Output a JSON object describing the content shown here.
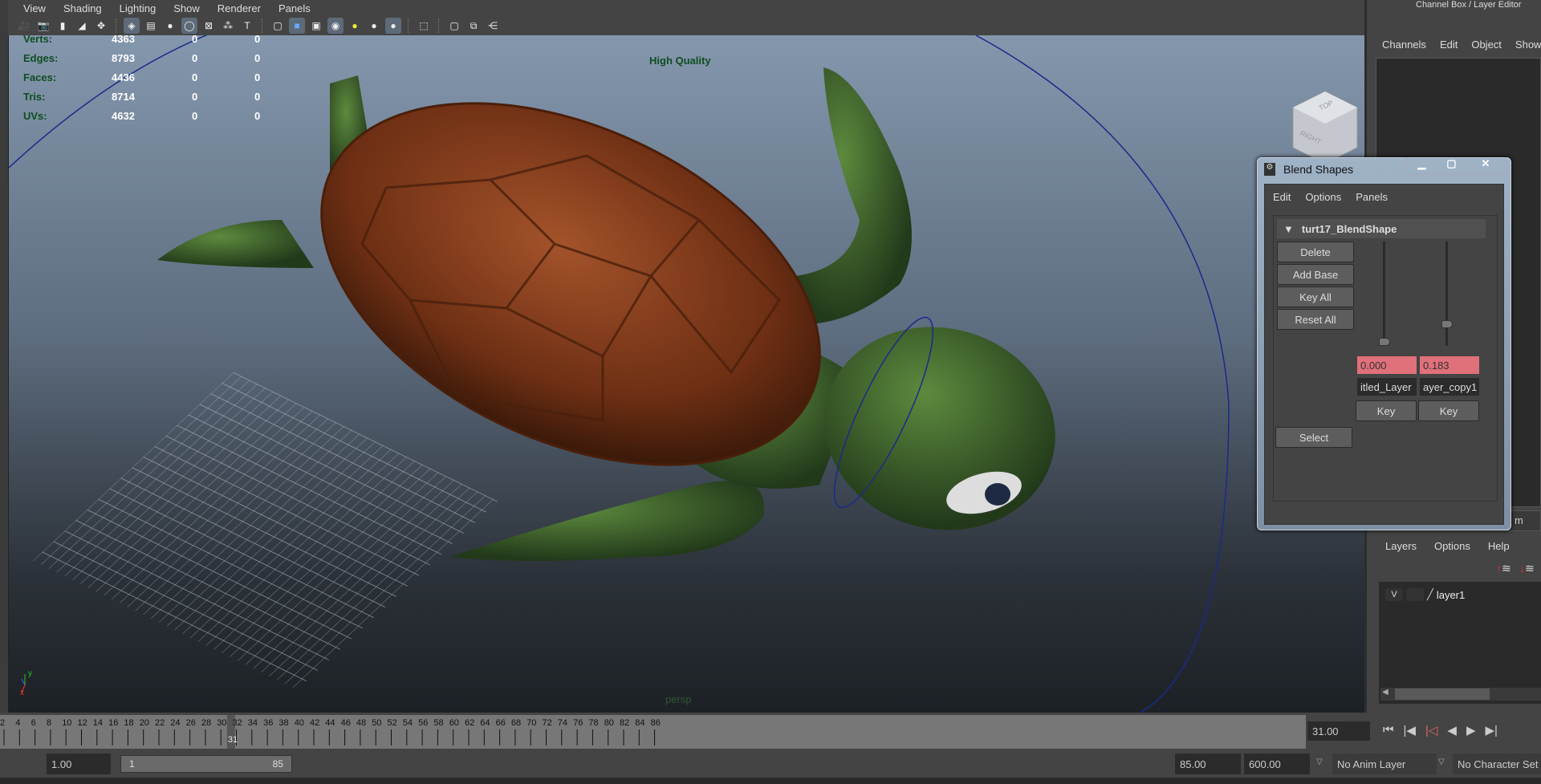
{
  "viewport_menu": [
    "View",
    "Shading",
    "Lighting",
    "Show",
    "Renderer",
    "Panels"
  ],
  "toolbar_icons": [
    "camera-icon",
    "camera-attributes-icon",
    "bookmark-icon",
    "image-plane-icon",
    "2d-pan-zoom-icon",
    "grid-icon",
    "film-gate-icon",
    "resolution-gate-icon",
    "gate-mask-icon",
    "field-chart-icon",
    "safe-action-icon",
    "safe-title-icon",
    "wireframe-icon",
    "smooth-shade-icon",
    "wireframe-on-shaded-icon",
    "textured-icon",
    "use-all-lights-icon",
    "shadows-icon",
    "screen-space-ao-icon",
    "select-highlight-icon",
    "isolate-select-icon",
    "xray-icon",
    "xray-joints-icon"
  ],
  "hud": {
    "stats": [
      {
        "label": "Verts:",
        "value": "4363",
        "sel": "0",
        "uv": "0"
      },
      {
        "label": "Edges:",
        "value": "8793",
        "sel": "0",
        "uv": "0"
      },
      {
        "label": "Faces:",
        "value": "4436",
        "sel": "0",
        "uv": "0"
      },
      {
        "label": "Tris:",
        "value": "8714",
        "sel": "0",
        "uv": "0"
      },
      {
        "label": "UVs:",
        "value": "4632",
        "sel": "0",
        "uv": "0"
      }
    ],
    "quality": "High Quality",
    "camera": "persp",
    "viewcube": {
      "top": "TOP",
      "right": "RIGHT"
    },
    "axis": {
      "x": "x",
      "y": "y"
    }
  },
  "channel_box": {
    "title": "Channel Box / Layer Editor",
    "menu": [
      "Channels",
      "Edit",
      "Object",
      "Show"
    ]
  },
  "layer_editor": {
    "menu": [
      "Layers",
      "Options",
      "Help"
    ],
    "layers": [
      {
        "visible": "V",
        "name": "layer1"
      }
    ],
    "tab_fragment": "m"
  },
  "blend_shapes": {
    "title": "Blend Shapes",
    "menu": [
      "Edit",
      "Options",
      "Panels"
    ],
    "node": "turt17_BlendShape",
    "buttons": {
      "delete": "Delete",
      "add_base": "Add Base",
      "key_all": "Key All",
      "reset_all": "Reset All",
      "select": "Select"
    },
    "targets": [
      {
        "value": "0.000",
        "weight": 0.0,
        "name": "itled_Layer",
        "key": "Key"
      },
      {
        "value": "0.183",
        "weight": 0.183,
        "name": "ayer_copy1",
        "key": "Key"
      }
    ]
  },
  "timeline": {
    "start": 2,
    "end": 86,
    "current_frame": "31",
    "current_time": "31.00"
  },
  "range": {
    "start_time": "1.00",
    "range_start": "1",
    "range_end": "85",
    "end_time": "85.00",
    "anim_end": "600.00",
    "anim_layer": "No Anim Layer",
    "character_set": "No Character Set"
  },
  "colors": {
    "accent_field": "#e0707a",
    "hud_green": "#0e4d21"
  }
}
